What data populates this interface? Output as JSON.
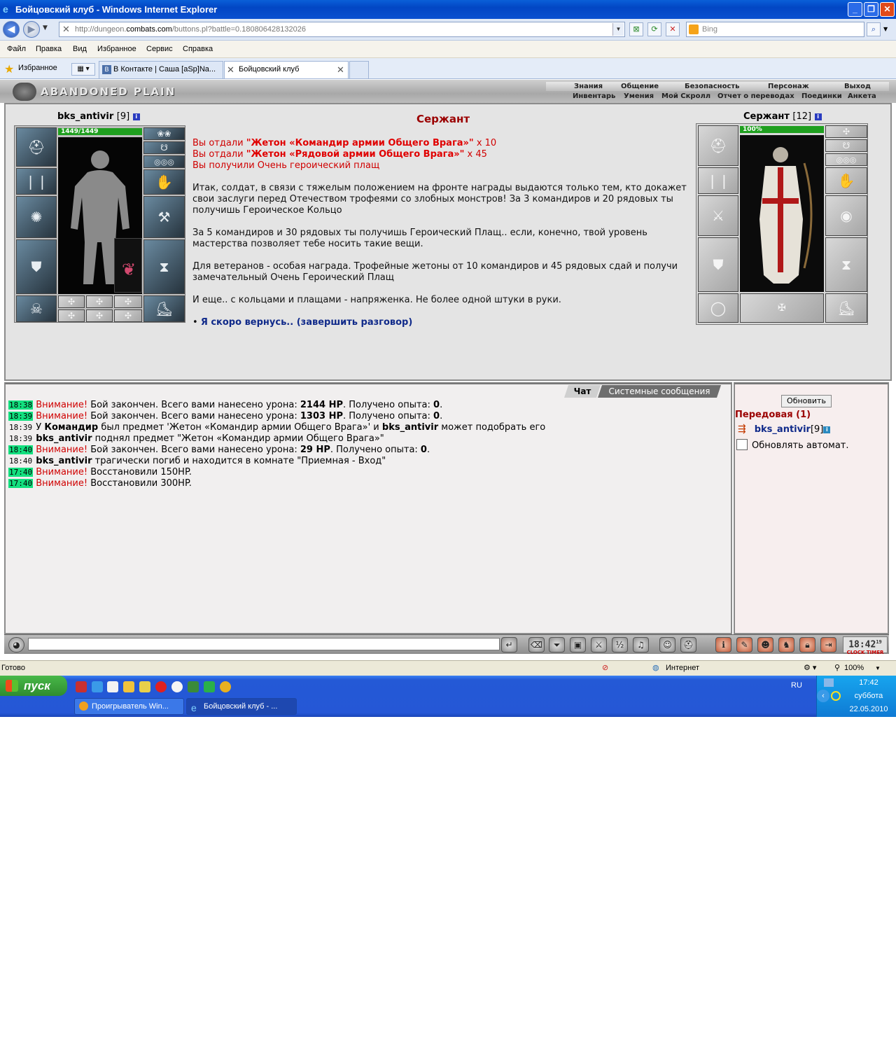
{
  "window": {
    "title": "Бойцовский клуб - Windows Internet Explorer"
  },
  "browser": {
    "address_prefix": "http://dungeon.",
    "address_domain": "combats.com",
    "address_suffix": "/buttons.pl?battle=0.180806428132026",
    "search_placeholder": "Bing",
    "menu": [
      "Файл",
      "Правка",
      "Вид",
      "Избранное",
      "Сервис",
      "Справка"
    ],
    "favorites_label": "Избранное",
    "tabs": [
      {
        "label": "В Контакте | Саша [aSp]Na..."
      },
      {
        "label": "Бойцовский клуб"
      }
    ]
  },
  "game": {
    "location": "ABANDONED PLAIN",
    "nav_top": [
      "Знания",
      "Общение",
      "Безопасность",
      "Персонаж",
      "Выход"
    ],
    "nav_bottom": [
      "Инвентарь",
      "Умения",
      "Мой Скролл",
      "Отчет о переводах",
      "Поединки",
      "Анкета"
    ],
    "player": {
      "name": "bks_antivir",
      "level": "[9]",
      "hp": "1449/1449",
      "hp_fraction": 1.0
    },
    "npc": {
      "name": "Сержант",
      "level": "[12]",
      "hp": "100%",
      "hp_fraction": 1.0
    },
    "dialog": {
      "title": "Сержант",
      "given1_prefix": "Вы отдали ",
      "given1_item": "\"Жетон «Командир армии Общего Врага»\"",
      "given1_count": " x 10",
      "given2_prefix": "Вы отдали ",
      "given2_item": "\"Жетон «Рядовой армии Общего Врага»\"",
      "given2_count": " x 45",
      "received": "Вы получили Очень героический плащ",
      "para1": "Итак, солдат, в связи с тяжелым положением на фронте награды выдаются только тем, кто докажет свои заслуги перед Отечеством трофеями со злобных монстров! За 3 командиров и 20 рядовых ты получишь Героическое Кольцо",
      "para2": "За 5 командиров и 30 рядовых ты получишь Героический Плащ.. если, конечно, твой уровень мастерства позволяет тебе носить такие вещи.",
      "para3": "Для ветеранов - особая награда. Трофейные жетоны от 10 командиров и 45 рядовых сдай и получи замечательный Очень Героический Плащ",
      "para4": "И еще.. с кольцами и плащами - напряженка. Не более одной штуки в руки.",
      "bullet": "•",
      "end_link": "Я скоро вернусь.. (завершить разговор)"
    },
    "chat_tabs": [
      "Чат",
      "Системные сообщения"
    ],
    "chat": [
      {
        "time": "18:38",
        "hl": true,
        "parts": [
          [
            "warn",
            "Внимание!"
          ],
          [
            "t",
            " Бой закончен. Всего вами нанесено урона: "
          ],
          [
            "b",
            "2144 HP"
          ],
          [
            "t",
            ". Получено опыта: "
          ],
          [
            "b",
            "0"
          ],
          [
            "t",
            "."
          ]
        ]
      },
      {
        "time": "18:39",
        "hl": true,
        "parts": [
          [
            "warn",
            "Внимание!"
          ],
          [
            "t",
            " Бой закончен. Всего вами нанесено урона: "
          ],
          [
            "b",
            "1303 HP"
          ],
          [
            "t",
            ". Получено опыта: "
          ],
          [
            "b",
            "0"
          ],
          [
            "t",
            "."
          ]
        ]
      },
      {
        "time": "18:39",
        "hl": false,
        "parts": [
          [
            "t",
            "У "
          ],
          [
            "b",
            "Командир"
          ],
          [
            "t",
            " был предмет 'Жетон «Командир армии Общего Врага»' и "
          ],
          [
            "b",
            "bks_antivir"
          ],
          [
            "t",
            " может подобрать его"
          ]
        ]
      },
      {
        "time": "18:39",
        "hl": false,
        "parts": [
          [
            "b",
            "bks_antivir"
          ],
          [
            "t",
            " поднял предмет \"Жетон «Командир армии Общего Врага»\""
          ]
        ]
      },
      {
        "time": "18:40",
        "hl": true,
        "parts": [
          [
            "warn",
            "Внимание!"
          ],
          [
            "t",
            " Бой закончен. Всего вами нанесено урона: "
          ],
          [
            "b",
            "29 HP"
          ],
          [
            "t",
            ". Получено опыта: "
          ],
          [
            "b",
            "0"
          ],
          [
            "t",
            "."
          ]
        ]
      },
      {
        "time": "18:40",
        "hl": false,
        "parts": [
          [
            "b",
            "bks_antivir"
          ],
          [
            "t",
            " трагически погиб и находится в комнате \"Приемная - Вход\""
          ]
        ]
      },
      {
        "time": "17:40",
        "hl": true,
        "parts": [
          [
            "warn",
            "Внимание!"
          ],
          [
            "t",
            " Восстановили 150HP."
          ]
        ]
      },
      {
        "time": "17:40",
        "hl": true,
        "parts": [
          [
            "warn",
            "Внимание!"
          ],
          [
            "t",
            " Восстановили 300HP."
          ]
        ]
      }
    ],
    "side": {
      "refresh_label": "Обновить",
      "frontline": "Передовая (1)",
      "player_name": "bks_antivir",
      "player_level": "[9]",
      "auto_refresh_label": "Обновлять автомат."
    },
    "clock": {
      "time": "18:42",
      "sec": "19",
      "clock_label": "CLOCK",
      "timer_label": "TIMER"
    }
  },
  "statusbar": {
    "status": "Готово",
    "zone": "Интернет",
    "zoom": "100%"
  },
  "taskbar": {
    "start": "пуск",
    "items": [
      "Проигрыватель Win...",
      "Бойцовский клуб - ..."
    ],
    "lang": "RU",
    "time": "17:42",
    "day": "суббота",
    "date": "22.05.2010"
  },
  "colors": {
    "npc_title": "#9b0000",
    "warning": "#d00000",
    "timestamp_highlight": "#12e07f",
    "link": "#102a8a",
    "hp_bar": "#1f9f1f"
  }
}
